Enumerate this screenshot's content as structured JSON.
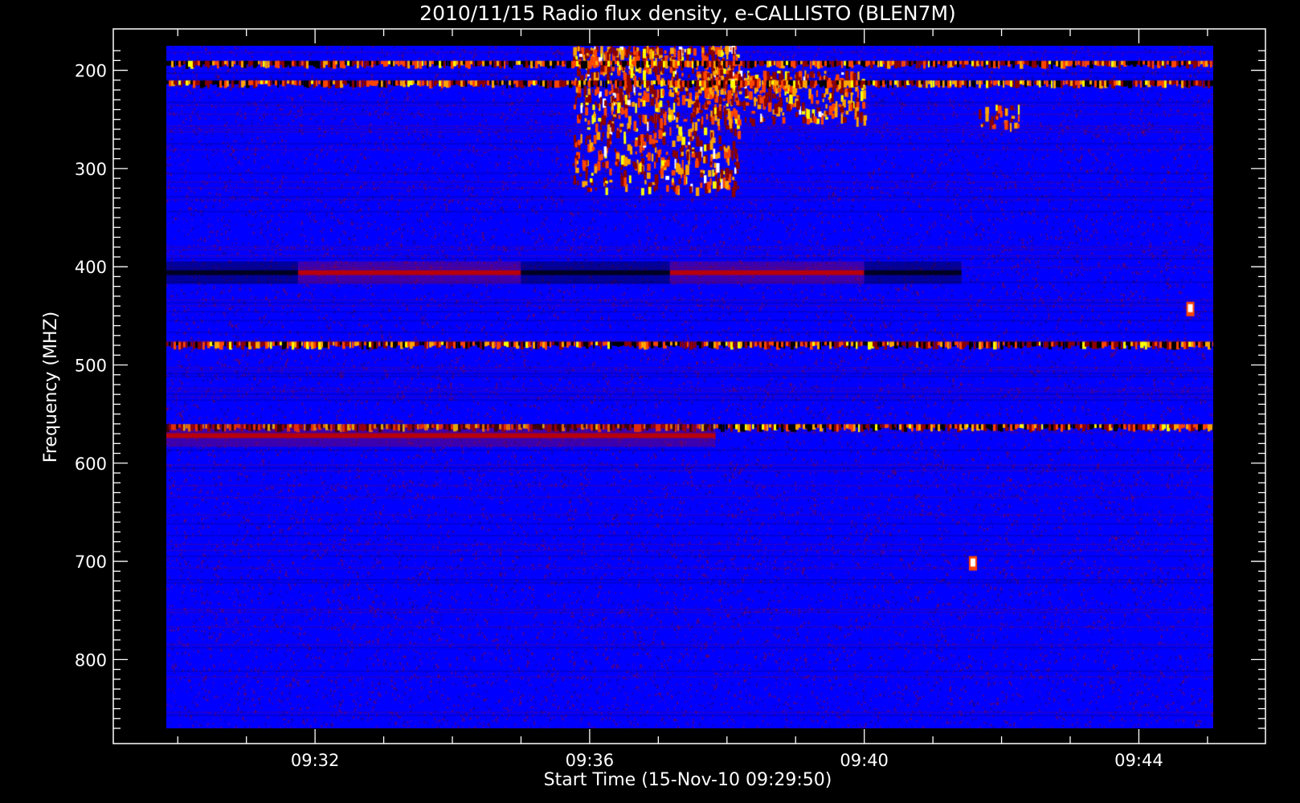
{
  "chart_data": {
    "type": "heatmap",
    "title": "2010/11/15  Radio flux density, e-CALLISTO (BLEN7M)",
    "xlabel": "Start Time (15-Nov-10 09:29:50)",
    "ylabel": "Frequency (MHZ)",
    "x_unit": "UT time",
    "xlim": [
      "09:29:50",
      "09:45:05"
    ],
    "ylim": [
      175,
      870
    ],
    "y_inverted": true,
    "x_ticks": [
      "09:32",
      "09:36",
      "09:40",
      "09:44"
    ],
    "y_ticks": [
      200,
      300,
      400,
      500,
      600,
      700,
      800
    ],
    "colormap": [
      "#000000",
      "#0000ff",
      "#8b0000",
      "#ff4500",
      "#ffa500",
      "#ffff00",
      "#ffffff"
    ],
    "background_color": "#0000ff",
    "features": [
      {
        "kind": "burst-cluster",
        "time": [
          "09:35:45",
          "09:38:10"
        ],
        "freq": [
          175,
          320
        ]
      },
      {
        "kind": "burst-cluster",
        "time": [
          "09:37:30",
          "09:40:00"
        ],
        "freq": [
          200,
          250
        ]
      },
      {
        "kind": "burst-cluster",
        "time": [
          "09:41:40",
          "09:42:15"
        ],
        "freq": [
          235,
          255
        ]
      },
      {
        "kind": "interference-line",
        "freq": 192,
        "time": [
          "09:29:50",
          "09:45:05"
        ]
      },
      {
        "kind": "interference-line",
        "freq": 212,
        "time": [
          "09:29:50",
          "09:45:05"
        ]
      },
      {
        "kind": "band",
        "freq": 406,
        "time": [
          "09:31:45",
          "09:35:00"
        ],
        "level": "high"
      },
      {
        "kind": "band",
        "freq": 406,
        "time": [
          "09:37:10",
          "09:40:00"
        ],
        "level": "high"
      },
      {
        "kind": "band",
        "freq": 406,
        "time": [
          "09:29:50",
          "09:31:45"
        ],
        "level": "low"
      },
      {
        "kind": "band",
        "freq": 406,
        "time": [
          "09:35:00",
          "09:37:10"
        ],
        "level": "low"
      },
      {
        "kind": "band",
        "freq": 406,
        "time": [
          "09:40:00",
          "09:41:25"
        ],
        "level": "low"
      },
      {
        "kind": "interference-line",
        "freq": 478,
        "time": [
          "09:29:50",
          "09:45:05"
        ]
      },
      {
        "kind": "interference-line",
        "freq": 562,
        "time": [
          "09:29:50",
          "09:45:05"
        ]
      },
      {
        "kind": "band",
        "freq": 572,
        "time": [
          "09:29:50",
          "09:37:50"
        ],
        "level": "high"
      },
      {
        "kind": "spot",
        "time": "09:41:35",
        "freq": 702
      },
      {
        "kind": "spot",
        "time": "09:44:45",
        "freq": 443
      }
    ]
  }
}
